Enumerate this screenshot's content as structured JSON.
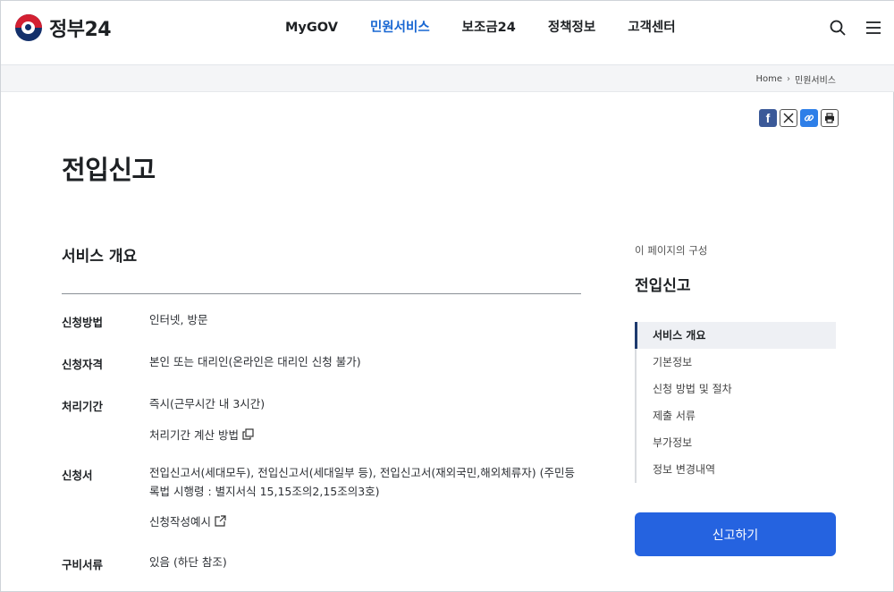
{
  "header": {
    "logo_text": "정부24",
    "nav": [
      {
        "label": "MyGOV",
        "active": false
      },
      {
        "label": "민원서비스",
        "active": true
      },
      {
        "label": "보조금24",
        "active": false
      },
      {
        "label": "정책정보",
        "active": false
      },
      {
        "label": "고객센터",
        "active": false
      }
    ],
    "icons": [
      "search-icon",
      "menu-icon"
    ],
    "accent_color": "#1967d2"
  },
  "breadcrumb": [
    "Home",
    "민원서비스"
  ],
  "share_icons": [
    "facebook-icon",
    "x-icon",
    "link-icon",
    "print-icon"
  ],
  "page_title": "전입신고",
  "overview": {
    "title": "서비스 개요",
    "rows": [
      {
        "label": "신청방법",
        "value": "인터넷, 방문"
      },
      {
        "label": "신청자격",
        "value": "본인 또는 대리인(온라인은 대리인 신청 불가)"
      },
      {
        "label": "처리기간",
        "value": "즉시(근무시간 내 3시간)",
        "link": "처리기간 계산 방법"
      },
      {
        "label": "신청서",
        "value": "전입신고서(세대모두), 전입신고서(세대일부 등), 전입신고서(재외국민,해외체류자) (주민등록법 시행령 : 별지서식 15,15조의2,15조의3호)",
        "link": "신청작성예시"
      },
      {
        "label": "구비서류",
        "value": "있음 (하단 참조)"
      }
    ]
  },
  "side": {
    "caption": "이 페이지의 구성",
    "title": "전입신고",
    "items": [
      {
        "label": "서비스 개요",
        "active": true
      },
      {
        "label": "기본정보",
        "active": false
      },
      {
        "label": "신청 방법 및 절차",
        "active": false
      },
      {
        "label": "제출 서류",
        "active": false
      },
      {
        "label": "부가정보",
        "active": false
      },
      {
        "label": "정보 변경내역",
        "active": false
      }
    ],
    "cta_label": "신고하기",
    "cta_color": "#2563e0"
  }
}
